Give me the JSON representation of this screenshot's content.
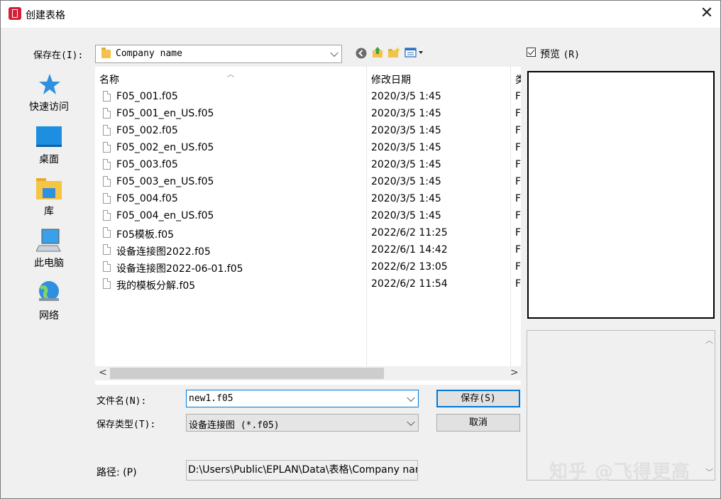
{
  "window": {
    "title": "创建表格",
    "close_symbol": "✕"
  },
  "location": {
    "label": "保存在(I):",
    "value": "Company name"
  },
  "toolbar": {
    "icons": [
      "back-icon",
      "up-folder-icon",
      "new-folder-icon",
      "view-menu-icon"
    ]
  },
  "preview": {
    "label": "预览",
    "shortcut": "(R)",
    "checked": true
  },
  "places": [
    {
      "label": "快速访问",
      "icon": "quick-access-star-icon"
    },
    {
      "label": "桌面",
      "icon": "desktop-icon"
    },
    {
      "label": "库",
      "icon": "library-icon"
    },
    {
      "label": "此电脑",
      "icon": "computer-icon"
    },
    {
      "label": "网络",
      "icon": "network-icon"
    }
  ],
  "columns": {
    "name": "名称",
    "date": "修改日期",
    "type": "类"
  },
  "files": [
    {
      "name": "F05_001.f05",
      "date": "2020/3/5 1:45",
      "type": "F"
    },
    {
      "name": "F05_001_en_US.f05",
      "date": "2020/3/5 1:45",
      "type": "F"
    },
    {
      "name": "F05_002.f05",
      "date": "2020/3/5 1:45",
      "type": "F"
    },
    {
      "name": "F05_002_en_US.f05",
      "date": "2020/3/5 1:45",
      "type": "F"
    },
    {
      "name": "F05_003.f05",
      "date": "2020/3/5 1:45",
      "type": "F"
    },
    {
      "name": "F05_003_en_US.f05",
      "date": "2020/3/5 1:45",
      "type": "F"
    },
    {
      "name": "F05_004.f05",
      "date": "2020/3/5 1:45",
      "type": "F"
    },
    {
      "name": "F05_004_en_US.f05",
      "date": "2020/3/5 1:45",
      "type": "F"
    },
    {
      "name": "F05模板.f05",
      "date": "2022/6/2 11:25",
      "type": "F"
    },
    {
      "name": "设备连接图2022.f05",
      "date": "2022/6/1 14:42",
      "type": "F"
    },
    {
      "name": "设备连接图2022-06-01.f05",
      "date": "2022/6/2 13:05",
      "type": "F"
    },
    {
      "name": "我的模板分解.f05",
      "date": "2022/6/2 11:54",
      "type": "F"
    }
  ],
  "filename": {
    "label": "文件名(N):",
    "value": "new1.f05"
  },
  "filetype": {
    "label": "保存类型(T):",
    "value": "设备连接图 (*.f05)"
  },
  "buttons": {
    "save": "保存(S)",
    "cancel": "取消"
  },
  "path": {
    "label": "路径: (P)",
    "value": "D:\\Users\\Public\\EPLAN\\Data\\表格\\Company name"
  },
  "watermark": "知乎 @飞得更高"
}
